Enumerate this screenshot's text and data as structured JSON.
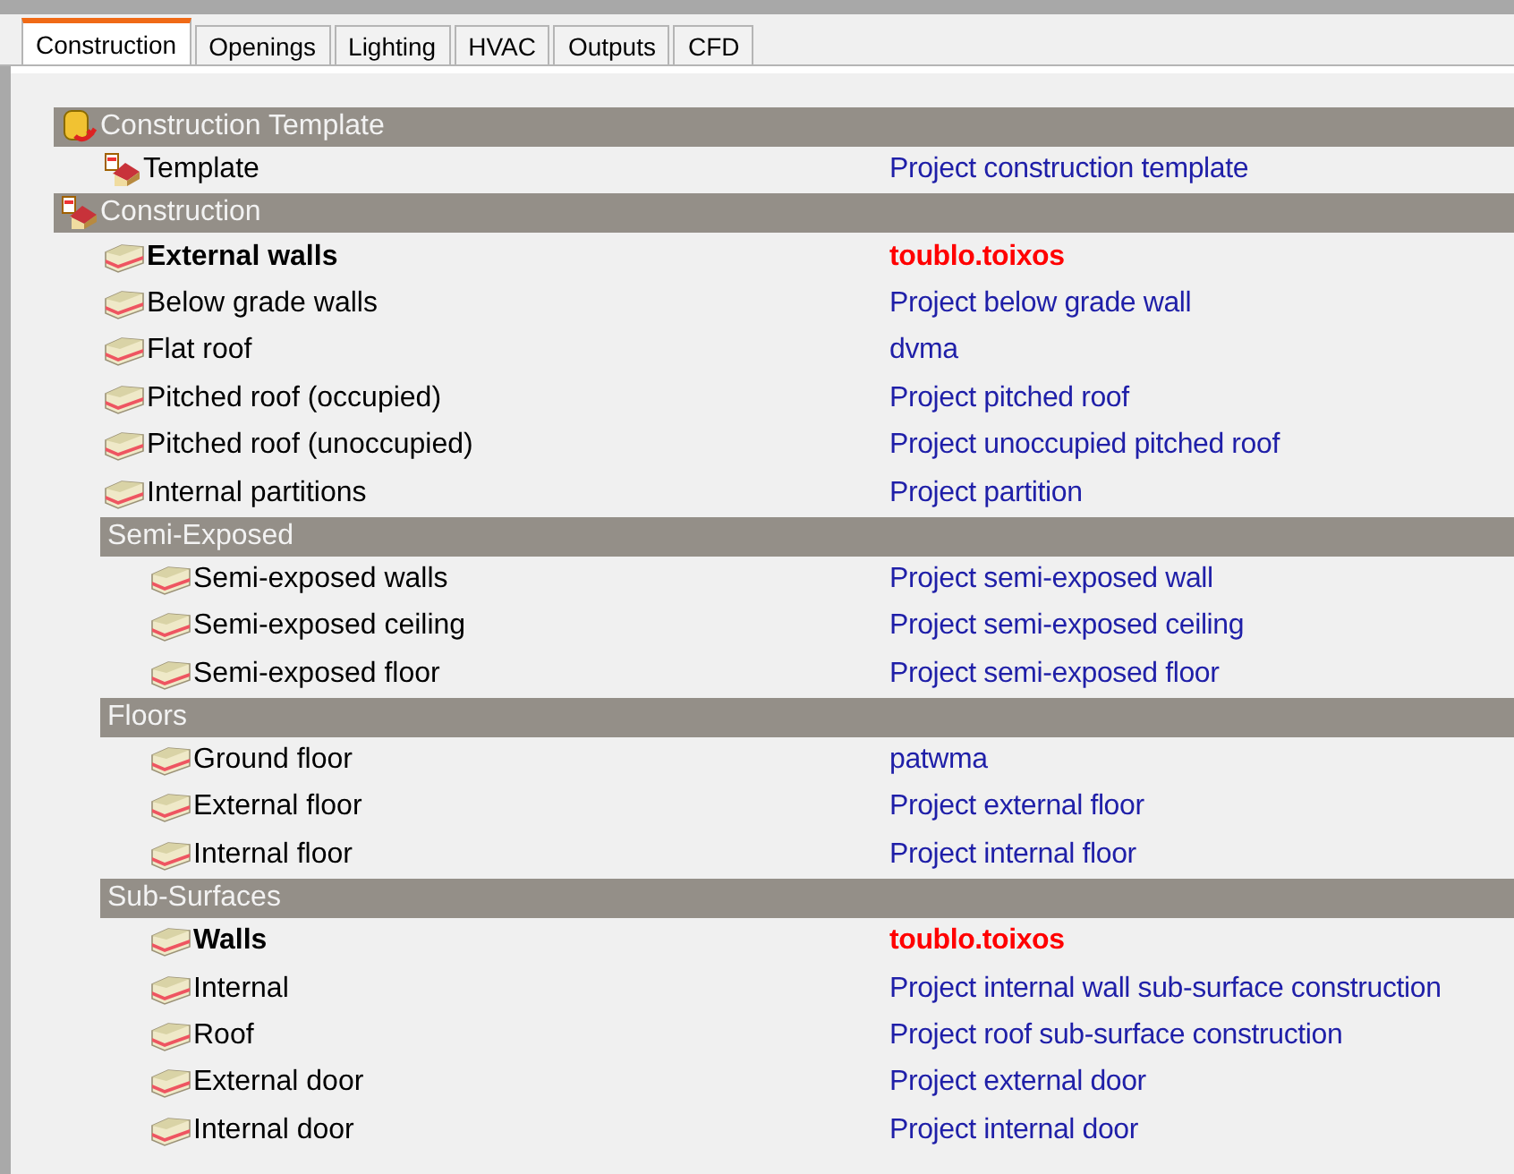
{
  "tabs": [
    {
      "label": "Construction",
      "selected": true
    },
    {
      "label": "Openings",
      "selected": false
    },
    {
      "label": "Lighting",
      "selected": false
    },
    {
      "label": "HVAC",
      "selected": false
    },
    {
      "label": "Outputs",
      "selected": false
    },
    {
      "label": "CFD",
      "selected": false
    }
  ],
  "sections": [
    {
      "title": "Construction Template",
      "kind": "template",
      "items": [
        {
          "label": "Template",
          "value": "Project construction template",
          "kind": "template",
          "overridden": false
        }
      ]
    },
    {
      "title": "Construction",
      "kind": "construction",
      "items": [
        {
          "label": "External walls",
          "value": "toublo.toixos",
          "kind": "layer",
          "overridden": true
        },
        {
          "label": "Below grade walls",
          "value": "Project below grade wall",
          "kind": "layer",
          "overridden": false
        },
        {
          "label": "Flat roof",
          "value": "dvma",
          "kind": "layer",
          "overridden": false
        },
        {
          "label": "Pitched roof (occupied)",
          "value": "Project pitched roof",
          "kind": "layer",
          "overridden": false
        },
        {
          "label": "Pitched roof (unoccupied)",
          "value": "Project unoccupied pitched roof",
          "kind": "layer",
          "overridden": false
        },
        {
          "label": "Internal partitions",
          "value": "Project partition",
          "kind": "layer",
          "overridden": false
        }
      ],
      "subsections": [
        {
          "title": "Semi-Exposed",
          "items": [
            {
              "label": "Semi-exposed walls",
              "value": "Project semi-exposed wall",
              "kind": "layer",
              "overridden": false
            },
            {
              "label": "Semi-exposed ceiling",
              "value": "Project semi-exposed ceiling",
              "kind": "layer",
              "overridden": false
            },
            {
              "label": "Semi-exposed floor",
              "value": "Project semi-exposed floor",
              "kind": "layer",
              "overridden": false
            }
          ]
        },
        {
          "title": "Floors",
          "items": [
            {
              "label": "Ground floor",
              "value": "patwma",
              "kind": "layer",
              "overridden": false
            },
            {
              "label": "External floor",
              "value": "Project external floor",
              "kind": "layer",
              "overridden": false
            },
            {
              "label": "Internal floor",
              "value": "Project internal floor",
              "kind": "layer",
              "overridden": false
            }
          ]
        },
        {
          "title": "Sub-Surfaces",
          "items": [
            {
              "label": "Walls",
              "value": "toublo.toixos",
              "kind": "layer",
              "overridden": true
            },
            {
              "label": "Internal",
              "value": "Project internal wall sub-surface construction",
              "kind": "layer",
              "overridden": false
            },
            {
              "label": "Roof",
              "value": "Project roof sub-surface construction",
              "kind": "layer",
              "overridden": false
            },
            {
              "label": "External door",
              "value": "Project external door",
              "kind": "layer",
              "overridden": false
            },
            {
              "label": "Internal door",
              "value": "Project internal door",
              "kind": "layer",
              "overridden": false
            }
          ]
        }
      ]
    }
  ]
}
